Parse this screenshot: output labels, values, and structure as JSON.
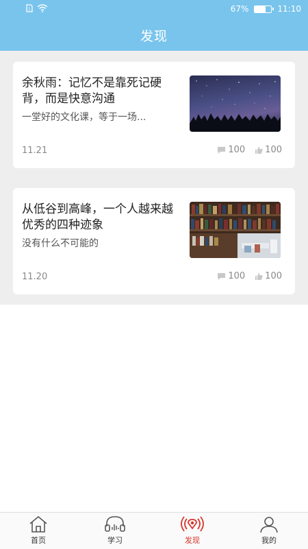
{
  "status_bar": {
    "battery": "67%",
    "battery_level": 0.67,
    "time": "11:10"
  },
  "header": {
    "title": "发现"
  },
  "articles": [
    {
      "title": "余秋雨：记忆不是靠死记硬背，而是快意沟通",
      "summary": "一堂好的文化课，等于一场...",
      "date": "11.21",
      "comments": "100",
      "likes": "100",
      "image": "starry-night-forest"
    },
    {
      "title": "从低谷到高峰，一个人越来越优秀的四种迹象",
      "summary": "没有什么不可能的",
      "date": "11.20",
      "comments": "100",
      "likes": "100",
      "image": "library-bookshelves"
    }
  ],
  "tabbar": {
    "items": [
      {
        "label": "首页",
        "icon": "home-icon"
      },
      {
        "label": "学习",
        "icon": "headphones-icon"
      },
      {
        "label": "发现",
        "icon": "broadcast-icon",
        "active": true
      },
      {
        "label": "我的",
        "icon": "user-icon"
      }
    ],
    "active_color": "#d9342b"
  },
  "colors": {
    "header": "#79c4ec",
    "feed_background": "#eeeeee"
  }
}
